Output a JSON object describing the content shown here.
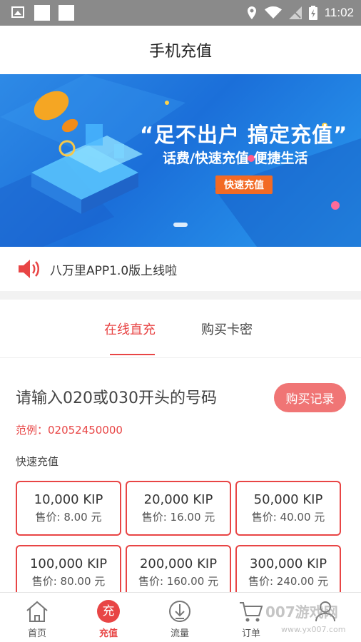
{
  "status_bar": {
    "time": "11:02"
  },
  "header": {
    "title": "手机充值"
  },
  "banner": {
    "headline": "“足不出户  搞定充值”",
    "subline": "话费/快速充值  便捷生活",
    "cta_label": "快速充值"
  },
  "notice": {
    "text": "八万里APP1.0版上线啦"
  },
  "tabs": [
    {
      "label": "在线直充",
      "active": true
    },
    {
      "label": "购买卡密",
      "active": false
    }
  ],
  "recharge": {
    "phone_placeholder": "请输入020或030开头的号码",
    "records_label": "购买记录",
    "example": "范例：02052450000",
    "quick_label": "快速充值",
    "options": [
      {
        "amount": "10,000 KIP",
        "price": "售价: 8.00 元"
      },
      {
        "amount": "20,000 KIP",
        "price": "售价: 16.00 元"
      },
      {
        "amount": "50,000 KIP",
        "price": "售价: 40.00 元"
      },
      {
        "amount": "100,000 KIP",
        "price": "售价: 80.00 元"
      },
      {
        "amount": "200,000 KIP",
        "price": "售价: 160.00 元"
      },
      {
        "amount": "300,000 KIP",
        "price": "售价: 240.00 元"
      }
    ]
  },
  "bottom_nav": [
    {
      "label": "首页",
      "icon": "home-icon"
    },
    {
      "label": "充值",
      "icon": "recharge-icon",
      "badge": "充",
      "active": true
    },
    {
      "label": "流量",
      "icon": "data-traffic-icon"
    },
    {
      "label": "订单",
      "icon": "cart-icon"
    }
  ],
  "watermark": {
    "text": "007游戏网",
    "url": "www.yx007.com"
  },
  "colors": {
    "accent": "#e84545",
    "banner_blue": "#1b6fd9",
    "cta_orange": "#f26a24",
    "records_bg": "#f07575"
  }
}
